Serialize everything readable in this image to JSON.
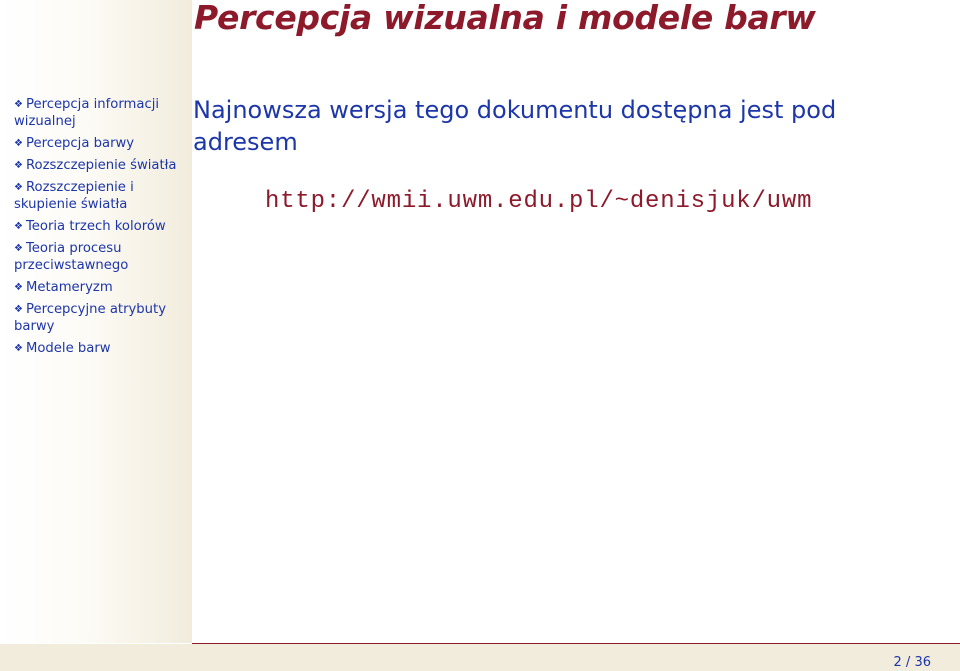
{
  "title": "Percepcja wizualna i modele barw",
  "sidebar": {
    "bullet_icon": "four-diamond-bullet-icon",
    "items": [
      {
        "label": "Percepcja informacji wizualnej"
      },
      {
        "label": "Percepcja barwy"
      },
      {
        "label": "Rozszczepienie światła"
      },
      {
        "label": "Rozszczepienie i skupienie światła"
      },
      {
        "label": "Teoria trzech kolorów"
      },
      {
        "label": "Teoria procesu przeciwstawnego"
      },
      {
        "label": "Metameryzm"
      },
      {
        "label": "Percepcyjne atrybuty barwy"
      },
      {
        "label": "Modele barw"
      }
    ]
  },
  "main": {
    "text": "Najnowsza wersja tego dokumentu dostępna jest pod adresem",
    "url": "http://wmii.uwm.edu.pl/~denisjuk/uwm"
  },
  "footer": {
    "page": "2 / 36"
  },
  "colors": {
    "title": "#8c1a2b",
    "text": "#1d36a8",
    "sidebar_bg": "#f1ecdc"
  }
}
